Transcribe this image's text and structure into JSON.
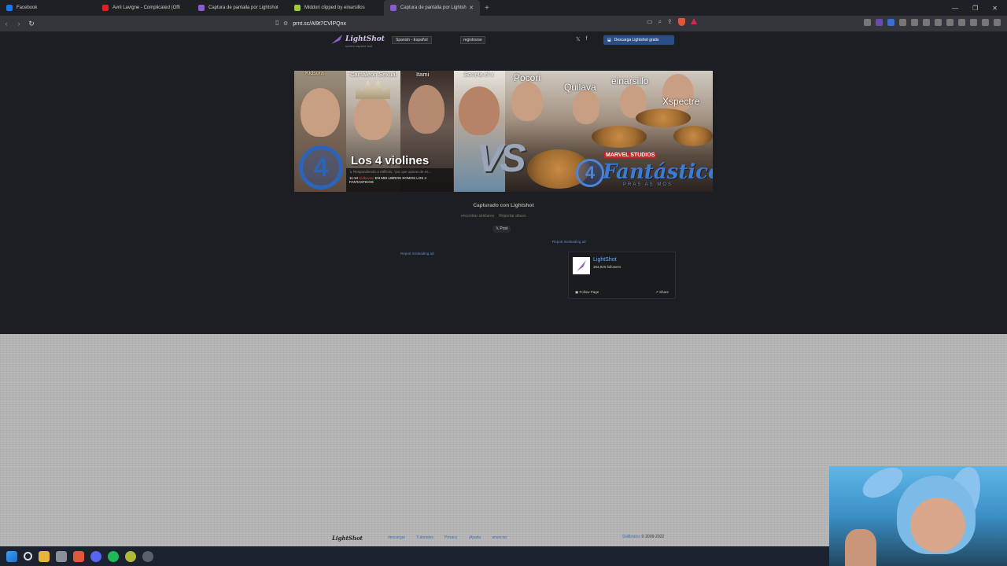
{
  "browser": {
    "tabs": [
      {
        "label": "Facebook",
        "color": "#1877f2"
      },
      {
        "label": "Avril Lavigne - Complicated (Offi",
        "color": "#e02020"
      },
      {
        "label": "Captura de pantalla por Lightshot",
        "color": "#8a5cd0"
      },
      {
        "label": "Middori clipped by einarsillos",
        "color": "#9ccc3c"
      },
      {
        "label": "Captura de pantalla por Lightsh",
        "color": "#8a5cd0"
      }
    ],
    "active_tab_index": 4,
    "tab_close": "✕",
    "new_tab": "+",
    "url": "prnt.sc/Al9t7CVlPQnx",
    "window_controls": [
      "—",
      "❐",
      "✕"
    ]
  },
  "header": {
    "logo": "LightShot",
    "logo_sub": "screen capture tool",
    "language": "Spanish - Español",
    "register": "registrarse",
    "download_button": "Descarga Lightshot gratis",
    "social": [
      "𝕏",
      "f"
    ]
  },
  "screenshot": {
    "names": [
      "Kidsora",
      "Camaleon Sexual",
      "Itami",
      "Boneta el x",
      "Pocori",
      "Quilava",
      "einarsillo",
      "Xspectre"
    ],
    "title_overlay": "Los 4 violines",
    "chat_reply": "↳ Respondiendo a n8fficks: \"por que opinas de es...",
    "chat_time": "11:13",
    "chat_user": "Kidkuvwo",
    "chat_message": "EN MIS LIBROS SOMOS LOS 4 FANTASTICOS",
    "vs": "VS",
    "four": "4",
    "marvel": "MARVEL STUDIOS",
    "fantasticos": "Fantásticos",
    "fantasticos_sub": "PRAS AS MOS"
  },
  "captured_label": "Capturado con Lightshot",
  "links": {
    "similar": "encontrar similares",
    "report": "Reportar abuso"
  },
  "post_button": "𝕏 Post",
  "report_ad_1": "Report misleading ad",
  "report_ad_2": "Report misleading ad",
  "fb_widget": {
    "name": "LightShot",
    "followers": "383,920 followers",
    "follow": "Follow Page",
    "share": "Share"
  },
  "footer": {
    "logo": "LightShot",
    "links": [
      "descargar",
      "Tutoriales",
      "Privacy",
      "¡Ayuda",
      "anunciar"
    ],
    "company": "Skillbrains",
    "copyright": "© 2009-2022"
  }
}
